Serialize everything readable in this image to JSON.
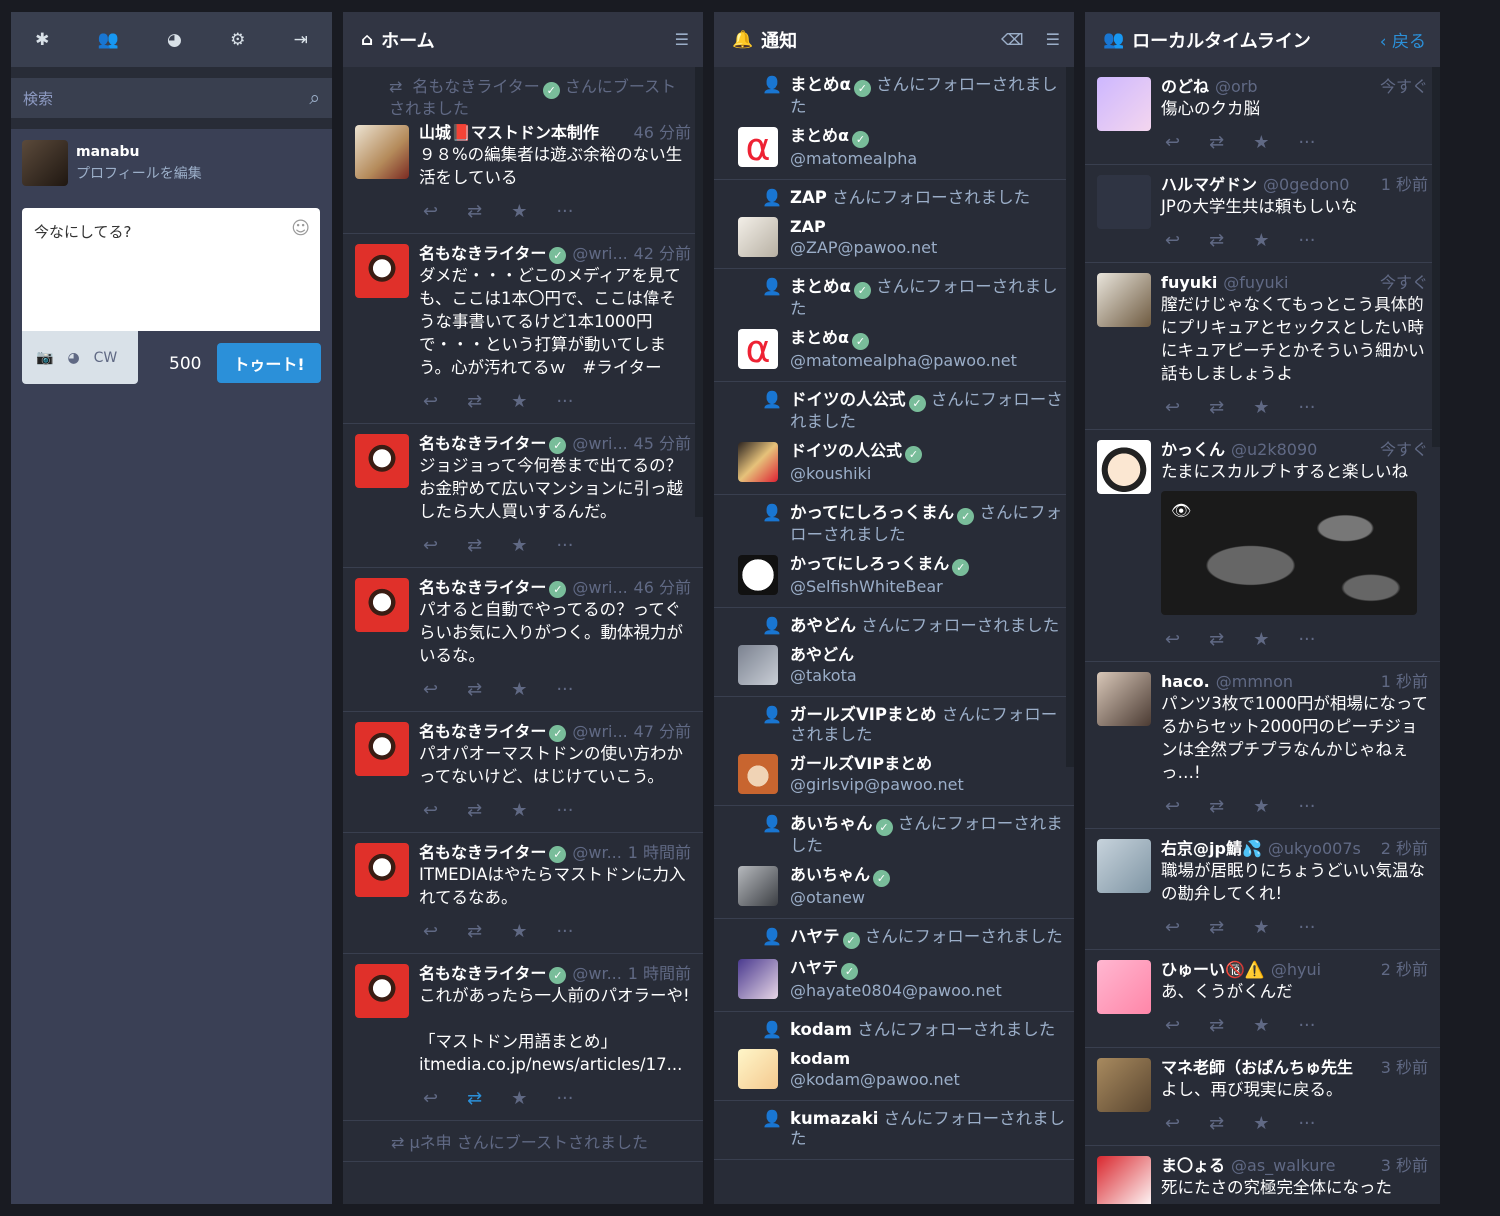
{
  "nav": {
    "icons": [
      "asterisk-icon",
      "users-icon",
      "globe-icon",
      "gear-icon",
      "logout-icon"
    ],
    "search_placeholder": "検索",
    "account": {
      "name": "manabu",
      "edit": "プロフィールを編集"
    },
    "compose_placeholder": "今なにしてる?",
    "cw": "CW",
    "counter": "500",
    "toot": "トゥート!"
  },
  "home": {
    "title": "ホーム",
    "boost_prefix": {
      "name": "名もなきライター",
      "text": "さんにブーストされました"
    },
    "statuses": [
      {
        "name": "山城📕マストドン本制作",
        "user": "",
        "time": "46 分前",
        "text": "９８%の編集者は遊ぶ余裕のない生活をしている",
        "avatar": "book"
      },
      {
        "name": "名もなきライター",
        "user": "@wri...",
        "time": "42 分前",
        "text": "ダメだ・・・どこのメディアを見ても、ここは1本〇円で、ここは偉そうな事書いてるけど1本1000円で・・・という打算が動いてしまう。心が汚れてるｗ　#ライター",
        "avatar": "red"
      },
      {
        "name": "名もなきライター",
        "user": "@wri...",
        "time": "45 分前",
        "text": "ジョジョって今何巻まで出てるの？お金貯めて広いマンションに引っ越したら大人買いするんだ。",
        "avatar": "red"
      },
      {
        "name": "名もなきライター",
        "user": "@wri...",
        "time": "46 分前",
        "text": "パオると自動でやってるの？ってぐらいお気に入りがつく。動体視力がいるな。",
        "avatar": "red"
      },
      {
        "name": "名もなきライター",
        "user": "@wri...",
        "time": "47 分前",
        "text": "パオパオーマストドンの使い方わかってないけど、はじけていこう。",
        "avatar": "red"
      },
      {
        "name": "名もなきライター",
        "user": "@wr...",
        "time": "1 時間前",
        "text": "ITMEDIAはやたらマストドンに力入れてるなあ。",
        "avatar": "red"
      },
      {
        "name": "名もなきライター",
        "user": "@wr...",
        "time": "1 時間前",
        "text": "これがあったら一人前のパオラーや!\n\n「マストドン用語まとめ」\nitmedia.co.jp/news/articles/17...",
        "avatar": "red",
        "boosted": true
      }
    ],
    "bottom_prefix": "μネ申 さんにブーストされました"
  },
  "notifications": {
    "title": "通知",
    "follow_suffix": "さんにフォローされました",
    "items": [
      {
        "name": "まとめα",
        "ver": true,
        "top_suffix": "さんにフォローされました",
        "user": "@matomealpha",
        "avatar": "alpha"
      },
      {
        "name": "ZAP",
        "ver": false,
        "top_suffix": "さんにフォローされました",
        "user": "@ZAP@pawoo.net",
        "avatar": "zap"
      },
      {
        "name": "まとめα",
        "ver": true,
        "top_suffix": "さんにフォローされました",
        "user": "@matomealpha@pawoo.net",
        "avatar": "alpha"
      },
      {
        "name": "ドイツの人公式",
        "ver": true,
        "top_suffix": "さんにフォローされました",
        "user": "@koushiki",
        "avatar": "doitsu"
      },
      {
        "name": "かってにしろっくまん",
        "ver": true,
        "top_suffix": "さんにフォローされました",
        "user": "@SelfishWhiteBear",
        "avatar": "panda"
      },
      {
        "name": "あやどん",
        "ver": false,
        "top_suffix": "さんにフォローされました",
        "user": "@takota",
        "avatar": "ayadon"
      },
      {
        "name": "ガールズVIPまとめ",
        "ver": false,
        "top_suffix": "さんにフォローされました",
        "user": "@girlsvip@pawoo.net",
        "avatar": "girls"
      },
      {
        "name": "あいちゃん",
        "ver": true,
        "top_suffix": "さんにフォローされました",
        "user": "@otanew",
        "avatar": "ai"
      },
      {
        "name": "ハヤテ",
        "ver": true,
        "top_suffix": "さんにフォローされました",
        "user": "@hayate0804@pawoo.net",
        "avatar": "hayate"
      },
      {
        "name": "kodam",
        "ver": false,
        "top_suffix": "さんにフォローされました",
        "user": "@kodam@pawoo.net",
        "avatar": "kodam"
      },
      {
        "name": "kumazaki",
        "ver": false,
        "top_suffix": "さんにフォローされました",
        "user": "",
        "avatar": "kuma"
      }
    ]
  },
  "local": {
    "title": "ローカルタイムライン",
    "back": "戻る",
    "statuses": [
      {
        "name": "のどね",
        "user": "@orb",
        "time": "今すぐ",
        "text": "傷心のクカ脳",
        "avatar": "nodone"
      },
      {
        "name": "ハルマゲドン",
        "user": "@0gedon0",
        "time": "1 秒前",
        "text": "JPの大学生共は頼もしいな",
        "avatar": "haru"
      },
      {
        "name": "fuyuki",
        "user": "@fuyuki",
        "time": "今すぐ",
        "text": "膣だけじゃなくてもっとこう具体的にプリキュアとセックスとしたい時にキュアピーチとかそういう細かい話もしましょうよ",
        "avatar": "fuyuki"
      },
      {
        "name": "かっくん",
        "user": "@u2k8090",
        "time": "今すぐ",
        "text": "たまにスカルプトすると楽しいね",
        "avatar": "kakkun",
        "media": true
      },
      {
        "name": "haco.",
        "user": "@mmnon",
        "time": "1 秒前",
        "text": "パンツ3枚で1000円が相場になってるからセット2000円のピーチジョンは全然プチプラなんかじゃねぇっ…!",
        "avatar": "haco"
      },
      {
        "name": "右京@jp鯖💦",
        "user": "@ukyo007s",
        "time": "2 秒前",
        "text": "職場が居眠りにちょうどいい気温なの勘弁してくれ!",
        "avatar": "ukyo"
      },
      {
        "name": "ひゅーい🔞⚠️",
        "user": "@hyui",
        "time": "2 秒前",
        "text": "あ、くうがくんだ",
        "avatar": "hyui"
      },
      {
        "name": "マネ老師（おぱんちゅ先生",
        "user": "",
        "time": "3 秒前",
        "text": "よし、再び現実に戻る。",
        "avatar": "cat"
      },
      {
        "name": "ま〇ょる",
        "user": "@as_walkure",
        "time": "3 秒前",
        "text": "死にたさの究極完全体になった",
        "avatar": "maru"
      }
    ]
  },
  "colors": {
    "bg": "#191b22",
    "column": "#282c37",
    "header": "#313543",
    "accent": "#2b90d9",
    "muted": "#606984",
    "verified": "#79bd9a"
  }
}
